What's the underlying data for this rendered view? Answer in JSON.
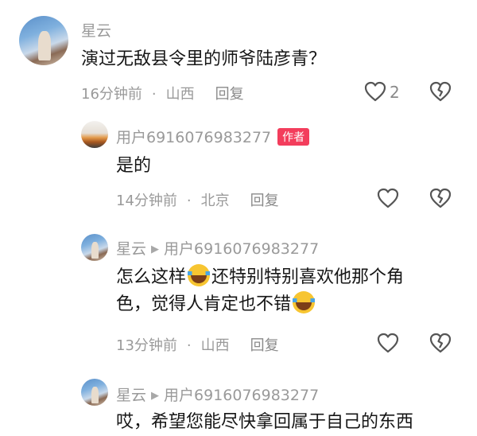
{
  "comments": [
    {
      "user": "星云",
      "text": "演过无敌县令里的师爷陆彦青？",
      "time": "16分钟前",
      "location": "山西",
      "reply": "回复",
      "likes": "2"
    },
    {
      "user": "用户6916076983277",
      "badge": "作者",
      "text": "是的",
      "time": "14分钟前",
      "location": "北京",
      "reply": "回复"
    },
    {
      "user": "星云",
      "reply_to": "用户6916076983277",
      "text_part1": "怎么这样",
      "text_part2": "还特别特别喜欢他那个角",
      "text_part3": "色，觉得人肯定也不错",
      "time": "13分钟前",
      "location": "山西",
      "reply": "回复"
    },
    {
      "user": "星云",
      "reply_to": "用户6916076983277",
      "text": "哎，希望您能尽快拿回属于自己的东西"
    }
  ],
  "icons": {
    "like": "heart-outline-icon",
    "dislike": "broken-heart-outline-icon",
    "reply_arrow": "right-triangle-icon",
    "emoji": "laughing-crying-emoji"
  }
}
